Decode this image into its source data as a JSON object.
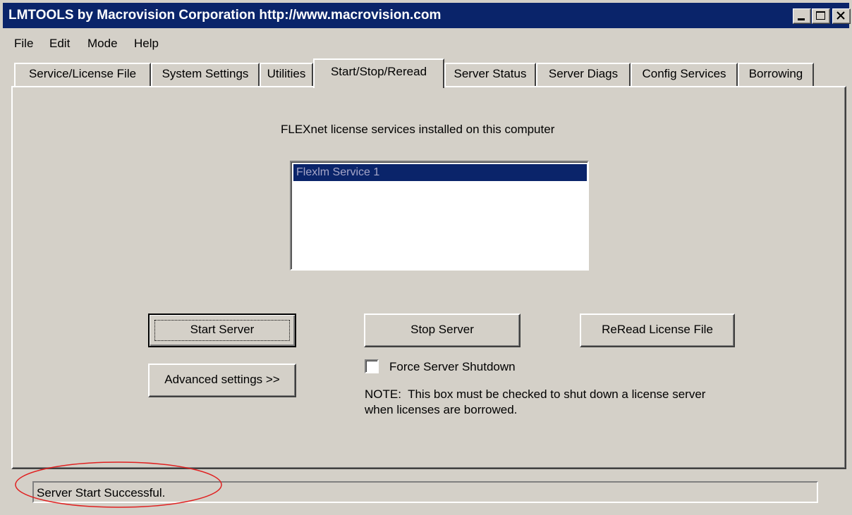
{
  "window": {
    "title": "LMTOOLS by Macrovision Corporation http://www.macrovision.com"
  },
  "menu": {
    "items": [
      "File",
      "Edit",
      "Mode",
      "Help"
    ]
  },
  "tabs": [
    {
      "label": "Service/License File"
    },
    {
      "label": "System Settings"
    },
    {
      "label": "Utilities"
    },
    {
      "label": "Start/Stop/Reread",
      "active": true
    },
    {
      "label": "Server Status"
    },
    {
      "label": "Server Diags"
    },
    {
      "label": "Config Services"
    },
    {
      "label": "Borrowing"
    }
  ],
  "panel": {
    "services_label": "FLEXnet license services installed on this computer",
    "services": [
      "Flexlm Service 1"
    ],
    "selected_service": "Flexlm Service 1",
    "buttons": {
      "start": "Start Server",
      "stop": "Stop Server",
      "reread": "ReRead License File",
      "advanced": "Advanced settings >>"
    },
    "force_shutdown": {
      "label": "Force Server Shutdown",
      "checked": false
    },
    "note_line1": "NOTE:  This box must be checked to shut down a license server",
    "note_line2": "when licenses are borrowed."
  },
  "status": {
    "text": "Server Start Successful."
  },
  "colors": {
    "titlebar": "#0a246a",
    "face": "#d4d0c8",
    "highlight_annotation": "#e02020"
  }
}
